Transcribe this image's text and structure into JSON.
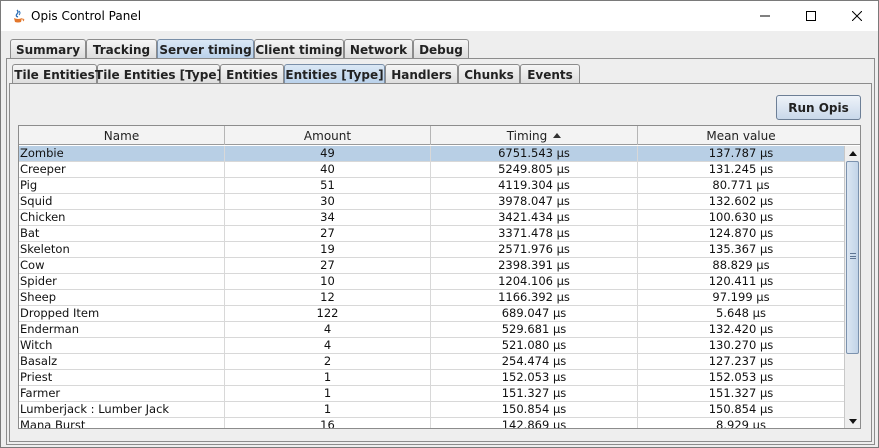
{
  "window": {
    "title": "Opis Control Panel"
  },
  "top_tabs": [
    {
      "label": "Summary",
      "active": false
    },
    {
      "label": "Tracking",
      "active": false
    },
    {
      "label": "Server timing",
      "active": true
    },
    {
      "label": "Client timing",
      "active": false
    },
    {
      "label": "Network",
      "active": false
    },
    {
      "label": "Debug",
      "active": false
    }
  ],
  "sub_tabs": [
    {
      "label": "Tile Entities",
      "active": false
    },
    {
      "label": "Tile Entities [Type]",
      "active": false
    },
    {
      "label": "Entities",
      "active": false
    },
    {
      "label": "Entities [Type]",
      "active": true
    },
    {
      "label": "Handlers",
      "active": false
    },
    {
      "label": "Chunks",
      "active": false
    },
    {
      "label": "Events",
      "active": false
    }
  ],
  "run_button": "Run Opis",
  "table": {
    "columns": [
      "Name",
      "Amount",
      "Timing",
      "Mean value"
    ],
    "sorted_column": "Timing",
    "selected_row": 0,
    "rows": [
      [
        "Zombie",
        "49",
        "6751.543 µs",
        "137.787 µs"
      ],
      [
        "Creeper",
        "40",
        "5249.805 µs",
        "131.245 µs"
      ],
      [
        "Pig",
        "51",
        "4119.304 µs",
        "80.771 µs"
      ],
      [
        "Squid",
        "30",
        "3978.047 µs",
        "132.602 µs"
      ],
      [
        "Chicken",
        "34",
        "3421.434 µs",
        "100.630 µs"
      ],
      [
        "Bat",
        "27",
        "3371.478 µs",
        "124.870 µs"
      ],
      [
        "Skeleton",
        "19",
        "2571.976 µs",
        "135.367 µs"
      ],
      [
        "Cow",
        "27",
        "2398.391 µs",
        "88.829 µs"
      ],
      [
        "Spider",
        "10",
        "1204.106 µs",
        "120.411 µs"
      ],
      [
        "Sheep",
        "12",
        "1166.392 µs",
        "97.199 µs"
      ],
      [
        "Dropped Item",
        "122",
        "689.047 µs",
        "5.648 µs"
      ],
      [
        "Enderman",
        "4",
        "529.681 µs",
        "132.420 µs"
      ],
      [
        "Witch",
        "4",
        "521.080 µs",
        "130.270 µs"
      ],
      [
        "Basalz",
        "2",
        "254.474 µs",
        "127.237 µs"
      ],
      [
        "Priest",
        "1",
        "152.053 µs",
        "152.053 µs"
      ],
      [
        "Farmer",
        "1",
        "151.327 µs",
        "151.327 µs"
      ],
      [
        "Lumberjack : Lumber Jack",
        "1",
        "150.854 µs",
        "150.854 µs"
      ],
      [
        "Mana Burst",
        "16",
        "142.869 µs",
        "8.929 µs"
      ]
    ]
  },
  "colors": {
    "selected_row": "#b8cfe5",
    "active_tab": "#b8d0ea"
  }
}
